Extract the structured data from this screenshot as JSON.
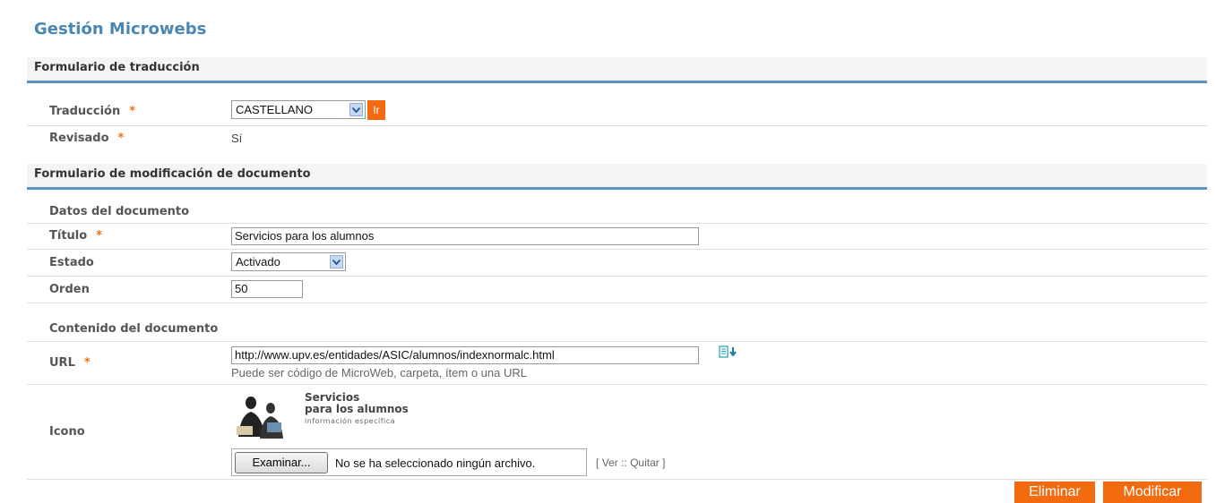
{
  "page": {
    "title": "Gestión Microwebs"
  },
  "translation_form": {
    "heading": "Formulario de traducción",
    "traduccion_label": "Traducción",
    "required_mark": "*",
    "traduccion_value": "CASTELLANO",
    "go_label": "Ir",
    "revisado_label": "Revisado",
    "revisado_value": "Sí"
  },
  "document_form": {
    "heading": "Formulario de modificación de documento",
    "datos_heading": "Datos del documento",
    "titulo_label": "Título",
    "titulo_value": "Servicios para los alumnos",
    "estado_label": "Estado",
    "estado_value": "Activado",
    "orden_label": "Orden",
    "orden_value": "50",
    "contenido_heading": "Contenido del documento",
    "url_label": "URL",
    "url_value": "http://www.upv.es/entidades/ASIC/alumnos/indexnormalc.html",
    "url_hint": "Puede ser código de MicroWeb, carpeta, ítem o una URL",
    "icono_label": "Icono",
    "icon_image": {
      "line1": "Servicios",
      "line2": "para los alumnos",
      "line3": "información específica"
    },
    "file_button": "Examinar...",
    "file_status": "No se ha seleccionado ningún archivo.",
    "link_open": "[",
    "ver_label": "Ver",
    "separator": "::",
    "quitar_label": "Quitar",
    "link_close": "]"
  },
  "actions": {
    "delete_label": "Eliminar",
    "modify_label": "Modificar"
  },
  "colors": {
    "accent": "#5b94bf",
    "title": "#4a86b4",
    "button": "#f26b10",
    "required": "#f07010"
  }
}
